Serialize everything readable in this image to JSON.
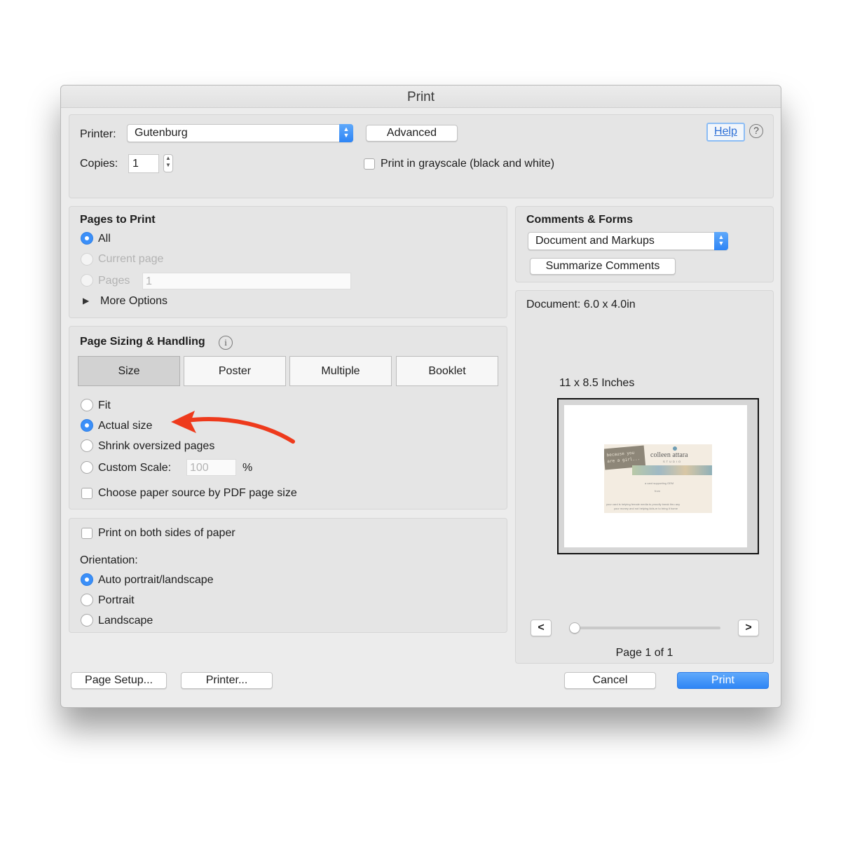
{
  "dialog": {
    "title": "Print",
    "printer": {
      "label": "Printer:",
      "value": "Gutenburg"
    },
    "advanced_label": "Advanced",
    "help_label": "Help",
    "help_icon": "?",
    "copies": {
      "label": "Copies:",
      "value": "1"
    },
    "grayscale_label": "Print in grayscale (black and white)",
    "pages_to_print": {
      "heading": "Pages to Print",
      "all": "All",
      "current_page": "Current page",
      "pages": "Pages",
      "pages_value": "1",
      "more_options": "More Options"
    },
    "page_sizing": {
      "heading": "Page Sizing & Handling",
      "info_icon": "i",
      "tabs": [
        "Size",
        "Poster",
        "Multiple",
        "Booklet"
      ],
      "fit": "Fit",
      "actual_size": "Actual size",
      "shrink": "Shrink oversized pages",
      "custom_scale": "Custom Scale:",
      "custom_scale_value": "100",
      "percent": "%",
      "paper_source": "Choose paper source by PDF page size"
    },
    "duplex_label": "Print on both sides of paper",
    "orientation": {
      "heading": "Orientation:",
      "auto": "Auto portrait/landscape",
      "portrait": "Portrait",
      "landscape": "Landscape"
    },
    "comments_forms": {
      "heading": "Comments & Forms",
      "value": "Document and Markups",
      "summarize": "Summarize Comments"
    },
    "preview": {
      "document_size": "Document: 6.0 x 4.0in",
      "paper_size": "11 x 8.5 Inches",
      "prev": "<",
      "next": ">",
      "page_label": "Page 1 of 1",
      "thumb_text": {
        "tag_line1": "because you",
        "tag_line2": "are a girl...",
        "brand": "colleen attara",
        "brand_sub": "STUDIO",
        "line1": "a card supporting GEM",
        "line2": "from",
        "line3": "your card is helping female media to proudly break thru any",
        "line4": "your money and not helping kids-m to bring it home"
      }
    },
    "footer": {
      "page_setup": "Page Setup...",
      "printer_btn": "Printer...",
      "cancel": "Cancel",
      "print": "Print"
    }
  },
  "colors": {
    "accent": "#3b8ff8",
    "annotation_arrow": "#ee3a1c"
  }
}
